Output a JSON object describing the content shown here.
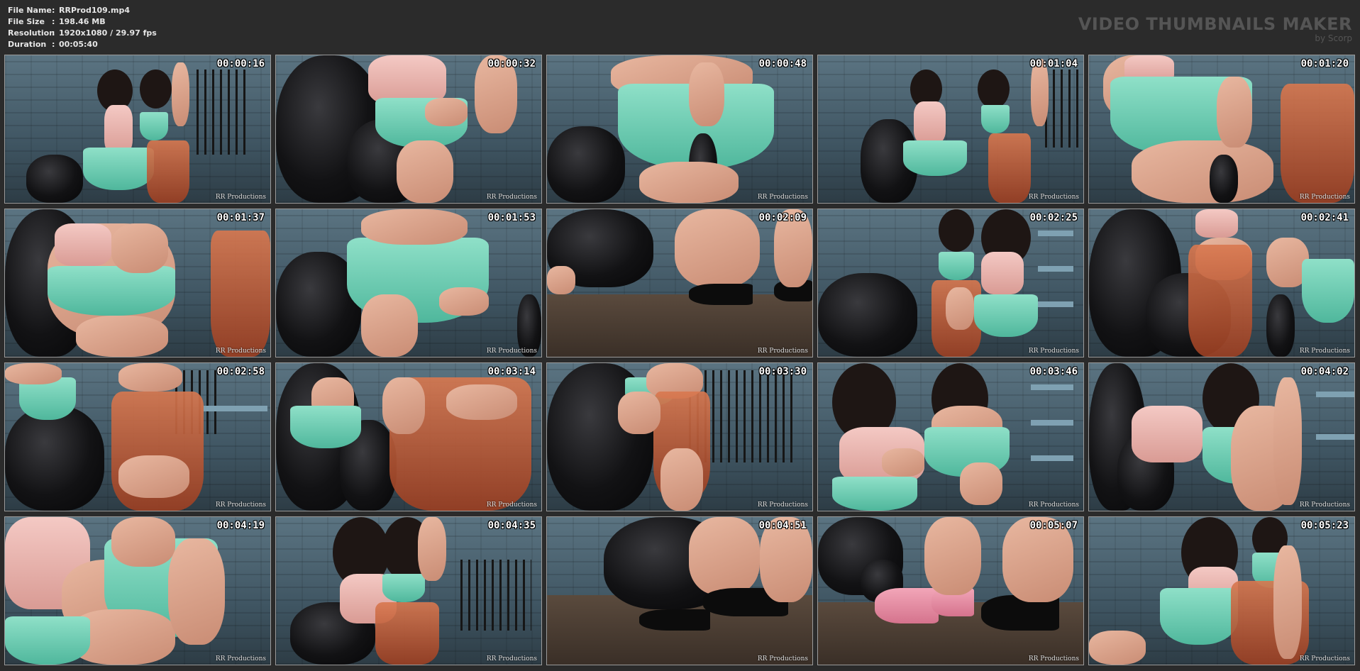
{
  "info": {
    "file_name_label": "File Name",
    "file_name": "RRProd109.mp4",
    "file_size_label": "File Size",
    "file_size": "198.46 MB",
    "resolution_label": "Resolution",
    "resolution": "1920x1080 / 29.97 fps",
    "duration_label": "Duration",
    "duration": "00:05:40",
    "separator": ":"
  },
  "brand": {
    "title": "VIDEO THUMBNAILS MAKER",
    "subtitle": "by Scorp"
  },
  "watermark": "RR Productions",
  "thumbnails": [
    {
      "time": "00:00:16"
    },
    {
      "time": "00:00:32"
    },
    {
      "time": "00:00:48"
    },
    {
      "time": "00:01:04"
    },
    {
      "time": "00:01:20"
    },
    {
      "time": "00:01:37"
    },
    {
      "time": "00:01:53"
    },
    {
      "time": "00:02:09"
    },
    {
      "time": "00:02:25"
    },
    {
      "time": "00:02:41"
    },
    {
      "time": "00:02:58"
    },
    {
      "time": "00:03:14"
    },
    {
      "time": "00:03:30"
    },
    {
      "time": "00:03:46"
    },
    {
      "time": "00:04:02"
    },
    {
      "time": "00:04:19"
    },
    {
      "time": "00:04:35"
    },
    {
      "time": "00:04:51"
    },
    {
      "time": "00:05:07"
    },
    {
      "time": "00:05:23"
    }
  ]
}
